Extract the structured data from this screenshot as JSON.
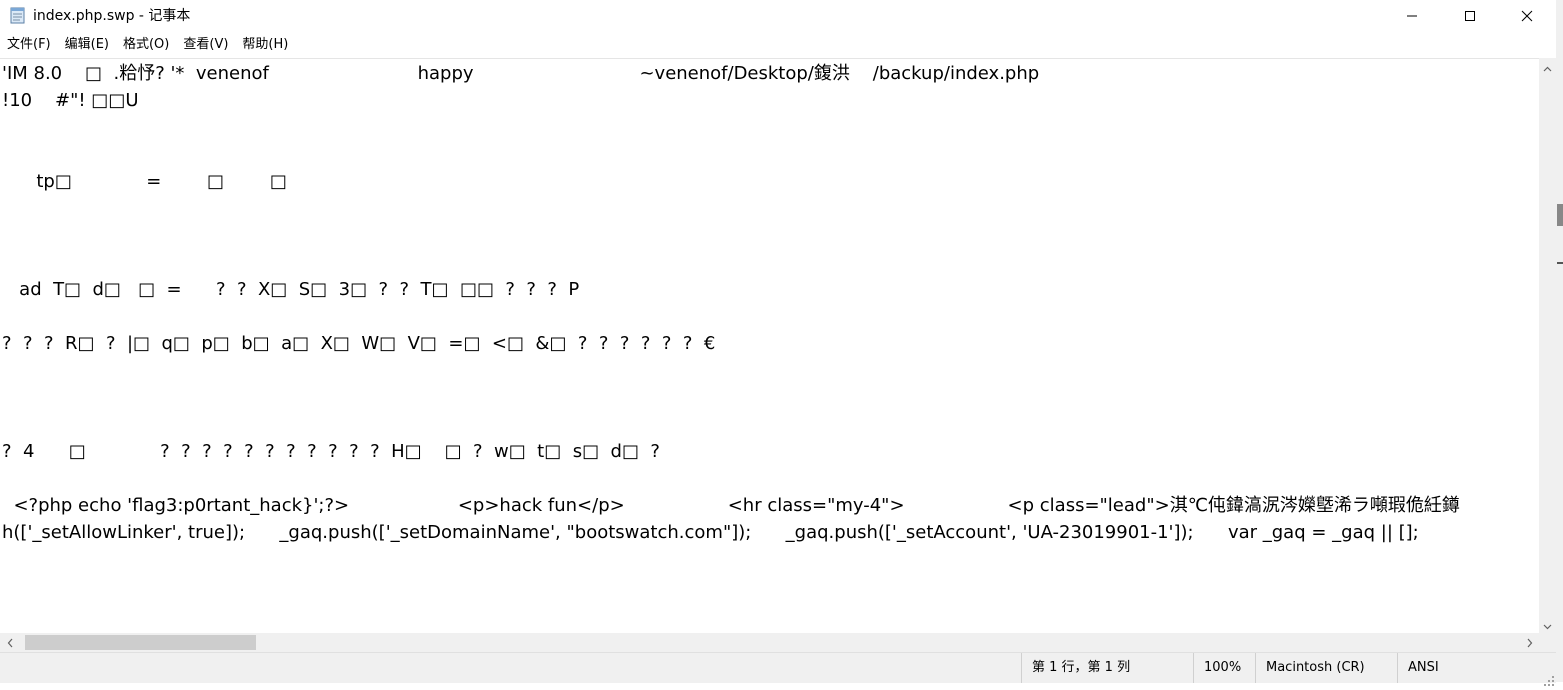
{
  "window": {
    "title": "index.php.swp - 记事本",
    "icon": "notepad-icon",
    "controls": {
      "minimize": "minimize-icon",
      "maximize": "maximize-icon",
      "close": "close-icon"
    }
  },
  "menu": {
    "items": [
      {
        "name": "menu-file",
        "label": "文件(F)"
      },
      {
        "name": "menu-edit",
        "label": "编辑(E)"
      },
      {
        "name": "menu-format",
        "label": "格式(O)"
      },
      {
        "name": "menu-view",
        "label": "查看(V)"
      },
      {
        "name": "menu-help",
        "label": "帮助(H)"
      }
    ]
  },
  "editor": {
    "lines": [
      "'IM 8.0    □  .粭忬? '*  venenof                          happy                             ~venenof/Desktop/鍑洪    /backup/index.php",
      "!10    #\"! □□U",
      "      tp□             =        □        □",
      "   ad  T□  d□   □  =      ?  ?  X□  S□  3□  ?  ?  T□  □□  ?  ?  ?  P",
      "?  ?  ?  R□  ?  |□  q□  p□  b□  a□  X□  W□  V□  =□  <□  &□  ?  ?  ?  ?  ?  ?  €",
      "?  4      □             ?  ?  ?  ?  ?  ?  ?  ?  ?  ?  ?  H□    □  ?  w□  t□  s□  d□  ?",
      "  <?php echo 'flag3:p0rtant_hack}';?>                   <p>hack fun</p>                  <hr class=\"my-4\">                  <p class=\"lead\">淇℃伅鍏滈泦涔嬫墍浠ラ噸瑕佹紝鐏",
      "h(['_setAllowLinker', true]);      _gaq.push(['_setDomainName', \"bootswatch.com\"]);      _gaq.push(['_setAccount', 'UA-23019901-1']);      var _gaq = _gaq || [];"
    ]
  },
  "status": {
    "position": "第 1 行，第 1 列",
    "zoom": "100%",
    "line_ending": "Macintosh (CR)",
    "encoding": "ANSI"
  }
}
